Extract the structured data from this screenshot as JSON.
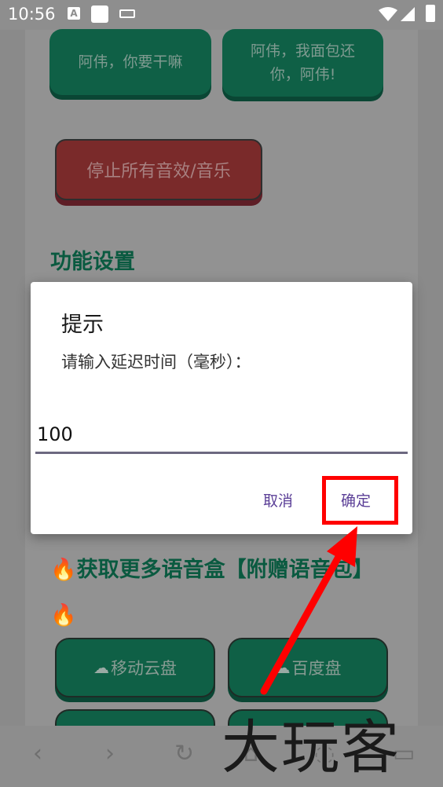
{
  "status_bar": {
    "time": "10:56",
    "a_badge": "A"
  },
  "page": {
    "buttons": [
      {
        "label": "阿伟，你要干嘛"
      },
      {
        "label": "阿伟，我面包还你，阿伟!"
      }
    ],
    "stop_all_button": "停止所有音效/音乐",
    "section_title": "功能设置",
    "more_title_prefix": "获取更多语音盒【附赠语音包】",
    "fire_emoji": "🔥",
    "download_buttons": [
      {
        "label": "移动云盘"
      },
      {
        "label": "百度盘"
      }
    ]
  },
  "dialog": {
    "title": "提示",
    "message": "请输入延迟时间（毫秒）：",
    "input_value": "100",
    "cancel_label": "取消",
    "confirm_label": "确定"
  },
  "watermark": "大玩客",
  "colors": {
    "green_button": "#0f6046",
    "red_button": "#7a2a2a",
    "dialog_button": "#5b3f97",
    "annotation": "#ff0000"
  }
}
